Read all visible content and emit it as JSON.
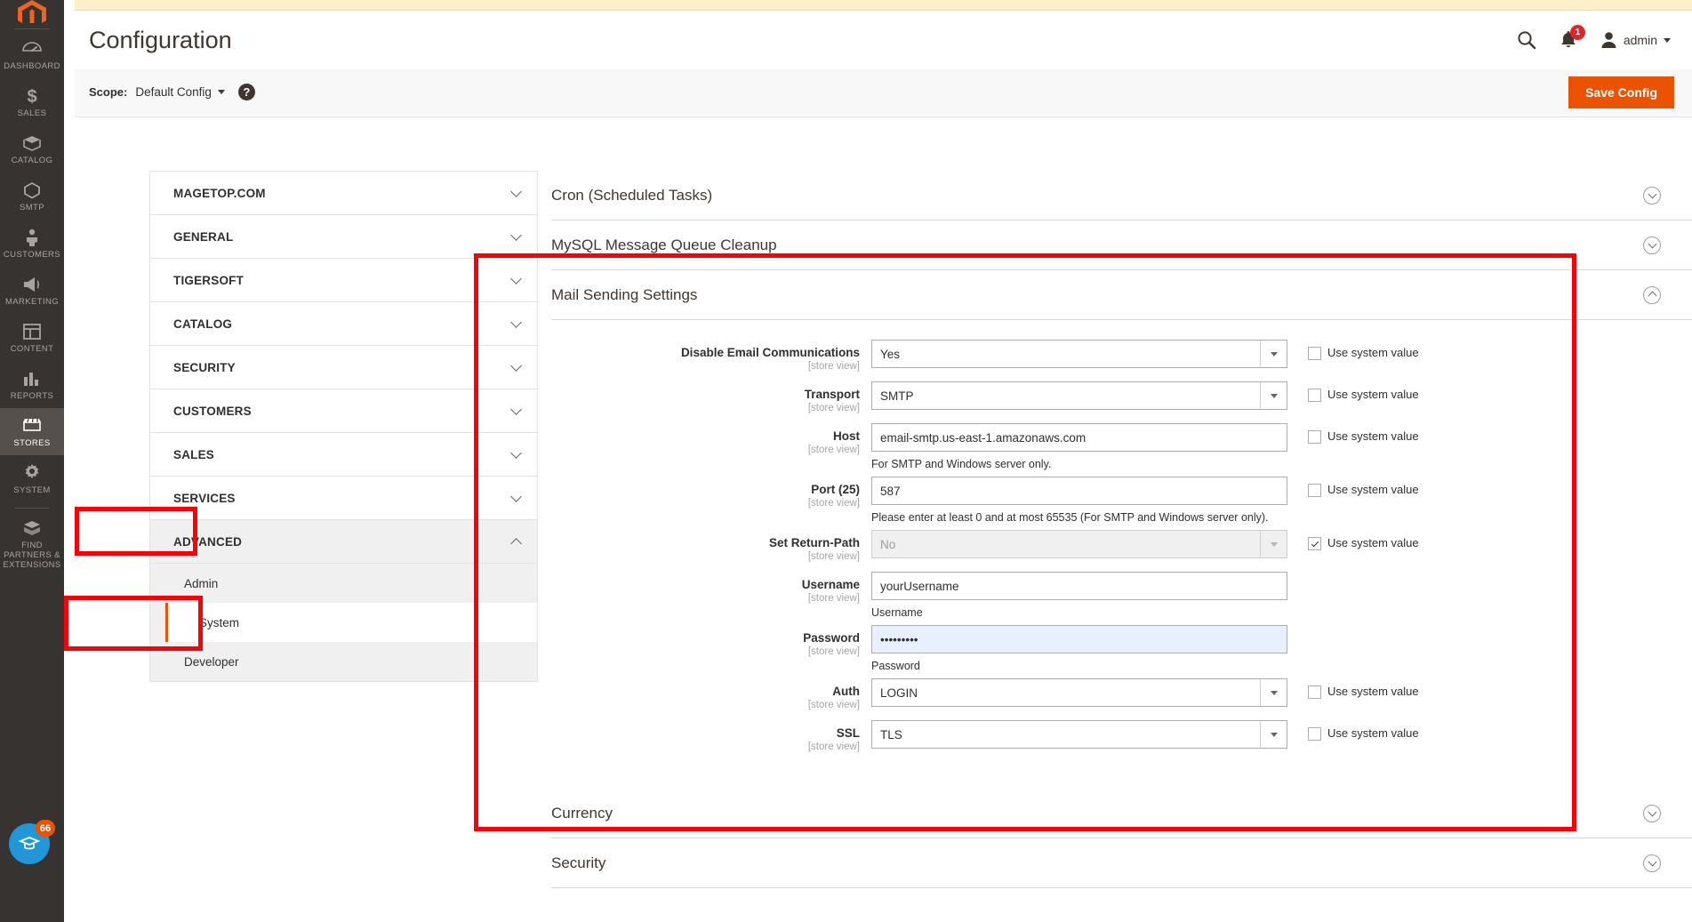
{
  "rail": {
    "items": [
      {
        "label": "DASHBOARD",
        "icon": "dashboard-icon",
        "active": false
      },
      {
        "label": "SALES",
        "icon": "sales-icon",
        "active": false
      },
      {
        "label": "CATALOG",
        "icon": "catalog-icon",
        "active": false
      },
      {
        "label": "SMTP",
        "icon": "smtp-icon",
        "active": false
      },
      {
        "label": "CUSTOMERS",
        "icon": "customers-icon",
        "active": false
      },
      {
        "label": "MARKETING",
        "icon": "marketing-icon",
        "active": false
      },
      {
        "label": "CONTENT",
        "icon": "content-icon",
        "active": false
      },
      {
        "label": "REPORTS",
        "icon": "reports-icon",
        "active": false
      },
      {
        "label": "STORES",
        "icon": "stores-icon",
        "active": true
      },
      {
        "label": "SYSTEM",
        "icon": "system-gear-icon",
        "active": false
      },
      {
        "label": "FIND PARTNERS & EXTENSIONS",
        "icon": "partners-box-icon",
        "active": false
      }
    ],
    "badge_count": "66"
  },
  "header": {
    "title": "Configuration",
    "search_icon": "search-icon",
    "notifications_icon": "bell-icon",
    "notifications_count": "1",
    "user_icon": "user-avatar-icon",
    "user_name": "admin"
  },
  "scope_bar": {
    "label": "Scope:",
    "selected": "Default Config",
    "help_icon": "question-mark-icon",
    "save_label": "Save Config"
  },
  "config_tree": {
    "sections": [
      {
        "label": "MAGETOP.COM",
        "open": false
      },
      {
        "label": "GENERAL",
        "open": false
      },
      {
        "label": "TIGERSOFT",
        "open": false
      },
      {
        "label": "CATALOG",
        "open": false
      },
      {
        "label": "SECURITY",
        "open": false
      },
      {
        "label": "CUSTOMERS",
        "open": false
      },
      {
        "label": "SALES",
        "open": false
      },
      {
        "label": "SERVICES",
        "open": false
      },
      {
        "label": "ADVANCED",
        "open": true
      }
    ],
    "advanced_children": [
      {
        "label": "Admin",
        "active": false
      },
      {
        "label": "System",
        "active": true
      },
      {
        "label": "Developer",
        "active": false
      }
    ]
  },
  "settings": {
    "top_sections": [
      {
        "title": "Cron (Scheduled Tasks)",
        "expanded": false
      },
      {
        "title": "MySQL Message Queue Cleanup",
        "expanded": false
      }
    ],
    "mail_section": {
      "title": "Mail Sending Settings",
      "expanded": true,
      "scope_note": "[store view]",
      "sysval_label": "Use system value",
      "fields": [
        {
          "label": "Disable Email Communications",
          "scope": "[store view]",
          "type": "select",
          "value": "Yes",
          "note": "",
          "disabled": false,
          "sysval_visible": true,
          "sysval_checked": false
        },
        {
          "label": "Transport",
          "scope": "[store view]",
          "type": "select",
          "value": "SMTP",
          "note": "",
          "disabled": false,
          "sysval_visible": true,
          "sysval_checked": false
        },
        {
          "label": "Host",
          "scope": "[store view]",
          "type": "text",
          "value": "email-smtp.us-east-1.amazonaws.com",
          "note": "For SMTP and Windows server only.",
          "disabled": false,
          "sysval_visible": true,
          "sysval_checked": false
        },
        {
          "label": "Port (25)",
          "scope": "[store view]",
          "type": "text",
          "value": "587",
          "note": "Please enter at least 0 and at most 65535 (For SMTP and Windows server only).",
          "disabled": false,
          "sysval_visible": true,
          "sysval_checked": false
        },
        {
          "label": "Set Return-Path",
          "scope": "[store view]",
          "type": "select",
          "value": "No",
          "note": "",
          "disabled": true,
          "sysval_visible": true,
          "sysval_checked": true
        },
        {
          "label": "Username",
          "scope": "[store view]",
          "type": "text",
          "value": "yourUsername",
          "note": "Username",
          "disabled": false,
          "sysval_visible": false,
          "sysval_checked": false
        },
        {
          "label": "Password",
          "scope": "[store view]",
          "type": "password",
          "value": "•••••••••",
          "note": "Password",
          "disabled": false,
          "autofill": true,
          "sysval_visible": false,
          "sysval_checked": false
        },
        {
          "label": "Auth",
          "scope": "[store view]",
          "type": "select",
          "value": "LOGIN",
          "note": "",
          "disabled": false,
          "sysval_visible": true,
          "sysval_checked": false
        },
        {
          "label": "SSL",
          "scope": "[store view]",
          "type": "select",
          "value": "TLS",
          "note": "",
          "disabled": false,
          "sysval_visible": true,
          "sysval_checked": false
        }
      ]
    },
    "bottom_sections": [
      {
        "title": "Currency",
        "expanded": false
      },
      {
        "title": "Security",
        "expanded": false
      }
    ]
  },
  "annotations": {
    "color": "#fb0007",
    "boxes": [
      {
        "name": "advanced-highlight"
      },
      {
        "name": "system-highlight"
      },
      {
        "name": "mail-sending-settings-highlight"
      }
    ]
  }
}
